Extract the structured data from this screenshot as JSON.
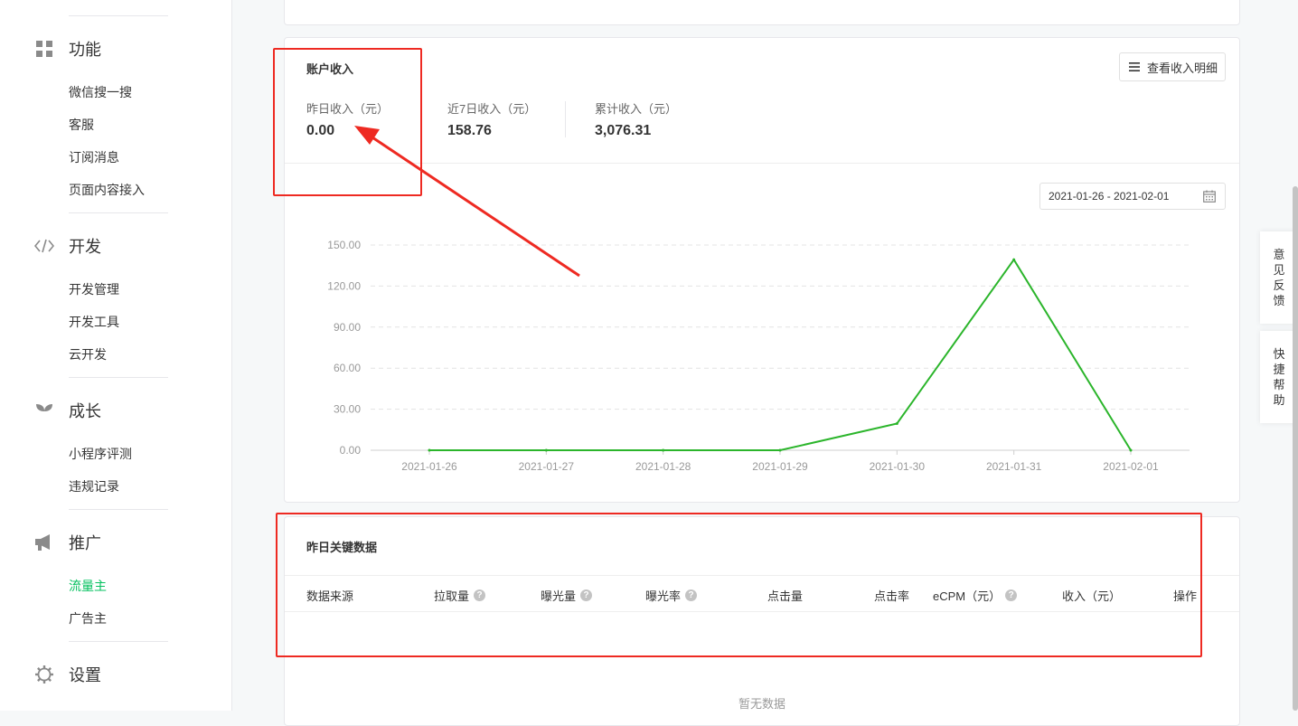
{
  "sidebar": {
    "sections": [
      {
        "title": "功能",
        "icon": "grid-icon",
        "items": [
          "微信搜一搜",
          "客服",
          "订阅消息",
          "页面内容接入"
        ]
      },
      {
        "title": "开发",
        "icon": "code-icon",
        "items": [
          "开发管理",
          "开发工具",
          "云开发"
        ]
      },
      {
        "title": "成长",
        "icon": "sprout-icon",
        "items": [
          "小程序评测",
          "违规记录"
        ]
      },
      {
        "title": "推广",
        "icon": "megaphone-icon",
        "items": [
          "流量主",
          "广告主"
        ],
        "active": "流量主"
      },
      {
        "title": "设置",
        "icon": "gear-icon",
        "items": []
      }
    ]
  },
  "income": {
    "title": "账户收入",
    "detail_button": "查看收入明细",
    "stats": [
      {
        "label": "昨日收入（元）",
        "value": "0.00"
      },
      {
        "label": "近7日收入（元）",
        "value": "158.76"
      },
      {
        "label": "累计收入（元）",
        "value": "3,076.31"
      }
    ],
    "date_range": "2021-01-26 - 2021-02-01"
  },
  "chart_data": {
    "type": "line",
    "x": [
      "2021-01-26",
      "2021-01-27",
      "2021-01-28",
      "2021-01-29",
      "2021-01-30",
      "2021-01-31",
      "2021-02-01"
    ],
    "y_ticks": [
      "0.00",
      "30.00",
      "60.00",
      "90.00",
      "120.00",
      "150.00"
    ],
    "ylim": [
      0,
      150
    ],
    "series": [
      {
        "values": [
          0,
          0,
          0,
          0,
          19.5,
          139.3,
          0
        ]
      }
    ],
    "color": "#2bb52b",
    "grid": true
  },
  "key_data": {
    "title": "昨日关键数据",
    "columns": [
      {
        "label": "数据来源",
        "help": false
      },
      {
        "label": "拉取量",
        "help": true
      },
      {
        "label": "曝光量",
        "help": true
      },
      {
        "label": "曝光率",
        "help": true
      },
      {
        "label": "点击量",
        "help": false
      },
      {
        "label": "点击率",
        "help": false
      },
      {
        "label": "eCPM（元）",
        "help": true
      },
      {
        "label": "收入（元）",
        "help": false
      },
      {
        "label": "操作",
        "help": false
      }
    ],
    "empty_text": "暂无数据"
  },
  "float_tabs": [
    {
      "chars": [
        "意",
        "见",
        "反",
        "馈"
      ]
    },
    {
      "chars": [
        "快",
        "捷",
        "帮",
        "助"
      ]
    }
  ],
  "colors": {
    "accent": "#07c160",
    "annotation": "#ee2a22",
    "line": "#2bb52b"
  }
}
